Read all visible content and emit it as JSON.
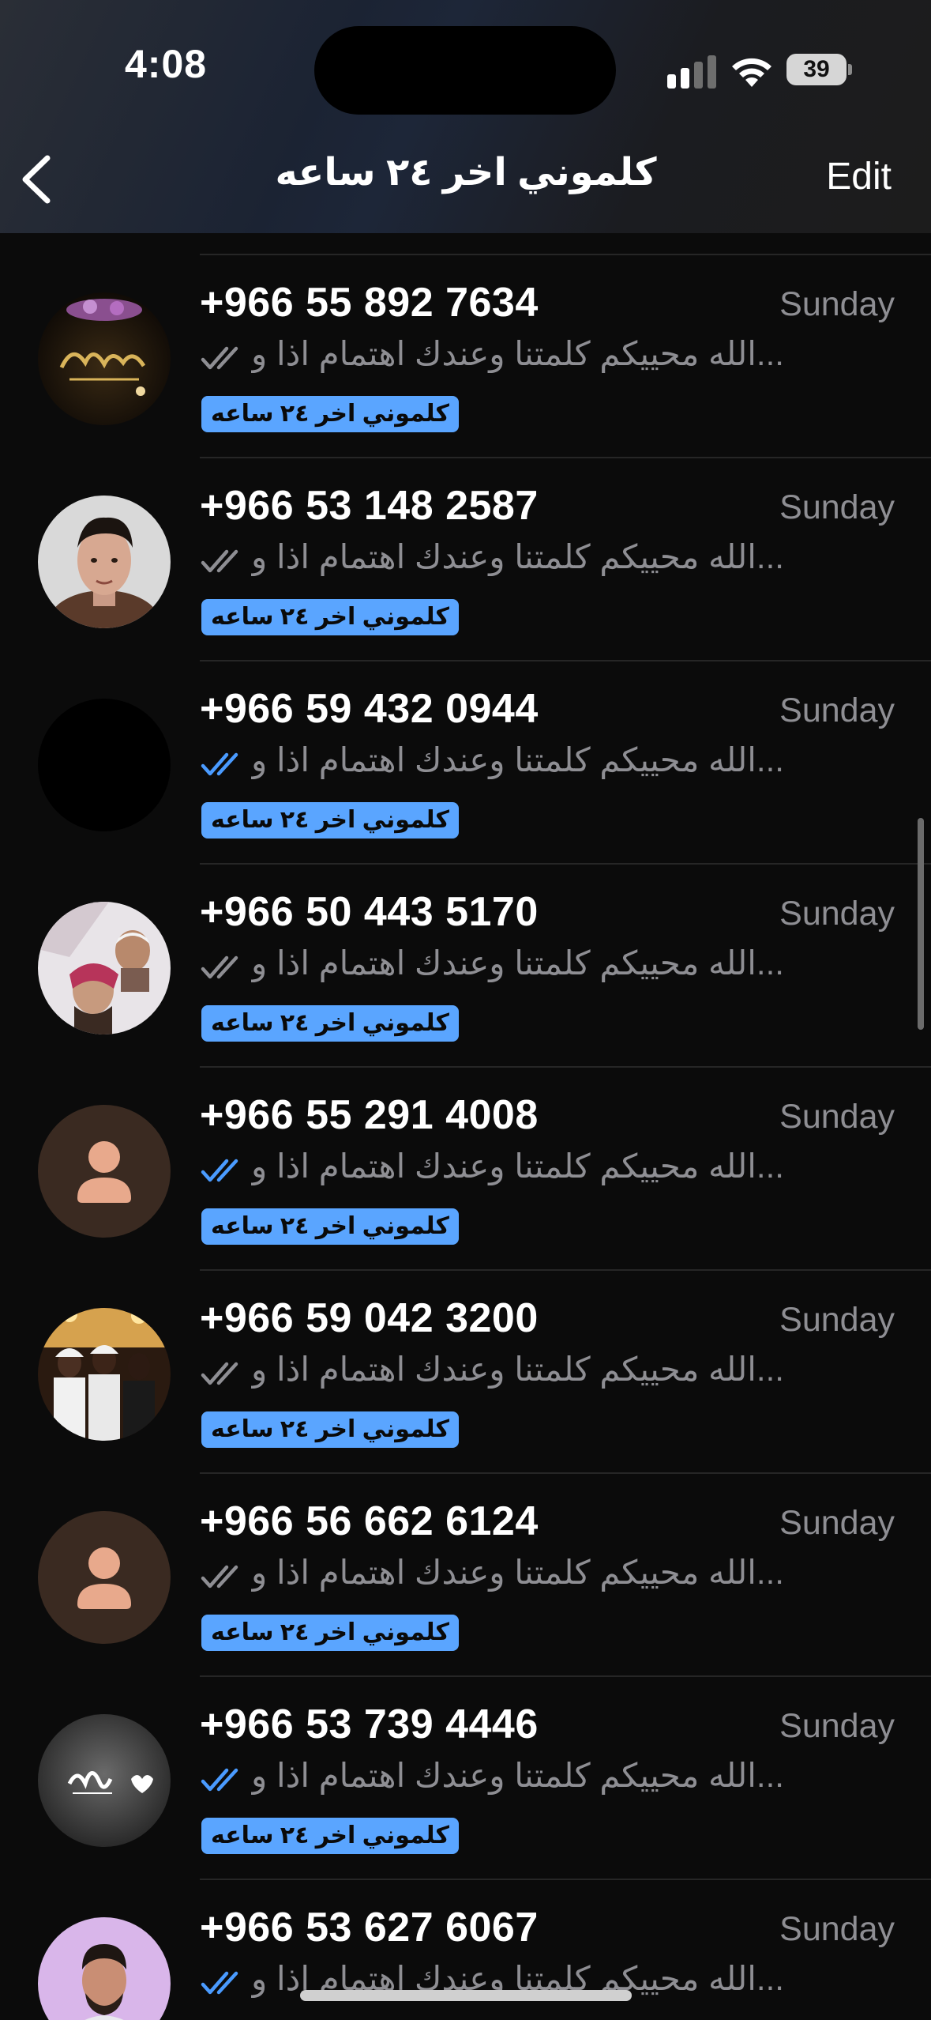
{
  "status_bar": {
    "time": "4:08",
    "battery": "39"
  },
  "nav": {
    "title": "كلموني اخر ٢٤ ساعه",
    "edit_label": "Edit"
  },
  "colors": {
    "accent": "#5aa5ff",
    "read_check": "#4a9bff",
    "sent_check": "#8e8e93"
  },
  "chats": [
    {
      "phone": "+966 55 892 7634",
      "date": "Sunday",
      "preview": "الله محييكم كلمتنا وعندك اهتمام اذا و...",
      "tag": "كلموني اخر ٢٤ ساعه",
      "read": false,
      "avatar": "gold-logo"
    },
    {
      "phone": "+966 53 148 2587",
      "date": "Sunday",
      "preview": "الله محييكم كلمتنا وعندك اهتمام اذا و...",
      "tag": "كلموني اخر ٢٤ ساعه",
      "read": false,
      "avatar": "man-portrait"
    },
    {
      "phone": "+966 59 432 0944",
      "date": "Sunday",
      "preview": "الله محييكم كلمتنا وعندك اهتمام اذا و...",
      "tag": "كلموني اخر ٢٤ ساعه",
      "read": true,
      "avatar": "black"
    },
    {
      "phone": "+966 50 443 5170",
      "date": "Sunday",
      "preview": "الله محييكم كلمتنا وعندك اهتمام اذا و...",
      "tag": "كلموني اخر ٢٤ ساعه",
      "read": false,
      "avatar": "selfie"
    },
    {
      "phone": "+966 55 291 4008",
      "date": "Sunday",
      "preview": "الله محييكم كلمتنا وعندك اهتمام اذا و...",
      "tag": "كلموني اخر ٢٤ ساعه",
      "read": true,
      "avatar": "default-person"
    },
    {
      "phone": "+966 59 042 3200",
      "date": "Sunday",
      "preview": "الله محييكم كلمتنا وعندك اهتمام اذا و...",
      "tag": "كلموني اخر ٢٤ ساعه",
      "read": false,
      "avatar": "group-photo"
    },
    {
      "phone": "+966 56 662 6124",
      "date": "Sunday",
      "preview": "الله محييكم كلمتنا وعندك اهتمام اذا و...",
      "tag": "كلموني اخر ٢٤ ساعه",
      "read": false,
      "avatar": "default-person"
    },
    {
      "phone": "+966 53 739 4446",
      "date": "Sunday",
      "preview": "الله محييكم كلمتنا وعندك اهتمام اذا و...",
      "tag": "كلموني اخر ٢٤ ساعه",
      "read": true,
      "avatar": "calligraphy"
    },
    {
      "phone": "+966 53 627 6067",
      "date": "Sunday",
      "preview": "الله محييكم كلمتنا وعندك اهتمام اذا و...",
      "tag": "",
      "read": true,
      "avatar": "man-purple"
    }
  ]
}
